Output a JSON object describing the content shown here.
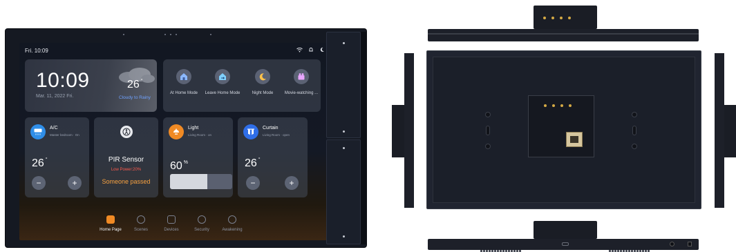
{
  "status_bar": {
    "date_time": "Fri. 10:09",
    "icons": [
      "wifi-icon",
      "bell-icon",
      "moon-icon"
    ]
  },
  "clock": {
    "time": "10:09",
    "date": "Mar. 11, 2022 Fri."
  },
  "weather": {
    "temp": "26",
    "unit": "°",
    "desc": "Cloudy to Rainy"
  },
  "modes": [
    {
      "label": "At Home Mode",
      "icon": "home-icon"
    },
    {
      "label": "Leave Home Mode",
      "icon": "leave-home-icon"
    },
    {
      "label": "Night Mode",
      "icon": "moon-icon"
    },
    {
      "label": "Movie-watching ...",
      "icon": "movie-icon"
    }
  ],
  "ac": {
    "name": "A/C",
    "room": "Master bedroom · On",
    "temp": "26",
    "unit": "°",
    "minus": "−",
    "plus": "+"
  },
  "pir": {
    "name": "PIR Sensor",
    "battery": "Low Power:20%",
    "status": "Someone passed"
  },
  "light": {
    "name": "Light",
    "room": "Living Room · on",
    "level": "60",
    "unit": "%",
    "level_fraction": 0.6
  },
  "curtain": {
    "name": "Curtain",
    "room": "Living Room · open",
    "temp": "26",
    "unit": "°",
    "minus": "−",
    "plus": "+"
  },
  "nav": [
    {
      "label": "Home Page",
      "icon": "home-icon",
      "active": true
    },
    {
      "label": "Scenes",
      "icon": "scenes-icon",
      "active": false
    },
    {
      "label": "Devices",
      "icon": "devices-icon",
      "active": false
    },
    {
      "label": "Security",
      "icon": "shield-icon",
      "active": false
    },
    {
      "label": "Awakening",
      "icon": "awakening-icon",
      "active": false
    }
  ],
  "colors": {
    "accent_orange": "#f08a24",
    "ac_blue": "#2f8ee8",
    "curtain_blue": "#2f6ee8",
    "low_power_red": "#ff5b4d",
    "weather_blue": "#6fa2ff"
  }
}
